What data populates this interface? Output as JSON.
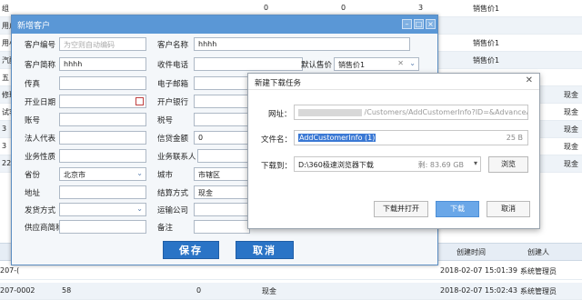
{
  "background": {
    "rows": [
      {
        "c1": "组",
        "c2": "0",
        "c3": "0",
        "c4": "3",
        "c5": "销售价1",
        "c6": ""
      },
      {
        "c1": "用户",
        "c2": "",
        "c3": "",
        "c4": "",
        "c5": "",
        "c6": ""
      },
      {
        "c1": "用小",
        "c2": "",
        "c3": "",
        "c4": "",
        "c5": "销售价1",
        "c6": ""
      },
      {
        "c1": "汽配",
        "c2": "",
        "c3": "",
        "c4": "",
        "c5": "销售价1",
        "c6": ""
      },
      {
        "c1": "五",
        "c2": "",
        "c3": "",
        "c4": "",
        "c5": "",
        "c6": ""
      },
      {
        "c1": "修理厂",
        "c2": "",
        "c3": "",
        "c4": "",
        "c5": "",
        "c6": "现金"
      },
      {
        "c1": "试客",
        "c2": "",
        "c3": "",
        "c4": "",
        "c5": "",
        "c6": "现金"
      },
      {
        "c1": "3",
        "c2": "",
        "c3": "",
        "c4": "",
        "c5": "",
        "c6": "现金"
      },
      {
        "c1": "3",
        "c2": "",
        "c3": "",
        "c4": "",
        "c5": "",
        "c6": "现金"
      },
      {
        "c1": "22",
        "c2": "",
        "c3": "",
        "c4": "",
        "c5": "",
        "c6": "现金"
      }
    ],
    "footer_headers": {
      "created_time": "创建时间",
      "creator": "创建人"
    },
    "footer_rows": [
      {
        "code": "207-(",
        "time": "2018-02-07 15:01:39",
        "creator": "系统管理员"
      },
      {
        "code": "207-0002",
        "num": "58",
        "zero": "0",
        "cash": "现金",
        "time": "2018-02-07 15:02:43",
        "creator": "系统管理员"
      }
    ]
  },
  "customer_dialog": {
    "title": "新增客户",
    "fields": {
      "code_label": "客户编号",
      "code_placeholder": "为空则自动编码",
      "name_label": "客户名称",
      "name_value": "hhhh",
      "short_label": "客户简称",
      "short_value": "hhhh",
      "phone_label": "收件电话",
      "default_price_label": "默认售价",
      "default_price_value": "销售价1",
      "fax_label": "传真",
      "email_label": "电子邮箱",
      "open_date_label": "开业日期",
      "bank_label": "开户银行",
      "account_label": "账号",
      "tax_label": "税号",
      "legal_label": "法人代表",
      "credit_label": "信贷金额",
      "credit_value": "0",
      "sales_label": "业务性质",
      "contact_label": "业务联系人",
      "province_label": "省份",
      "province_value": "北京市",
      "city_label": "城市",
      "city_value": "市辖区",
      "address_label": "地址",
      "settle_label": "结算方式",
      "settle_value": "现金",
      "ship_label": "发货方式",
      "logistics_label": "运输公司",
      "supplier_label": "供应商简称",
      "remark_label": "备注"
    },
    "save_label": "保存",
    "cancel_label": "取消"
  },
  "download_dialog": {
    "title": "新建下载任务",
    "url_label": "网址：",
    "url_value": "/Customers/AddCustomerInfo?ID=&AdvanceAmou",
    "filename_label": "文件名：",
    "filename_value": "AddCustomerInfo (1)",
    "filesize": "25 B",
    "saveto_label": "下载到：",
    "saveto_path": "D:\\360极速浏览器下载",
    "free_space": "剩: 83.69 GB",
    "browse_label": "浏览",
    "open_after_label": "下载并打开",
    "download_label": "下载",
    "cancel_label": "取消"
  }
}
